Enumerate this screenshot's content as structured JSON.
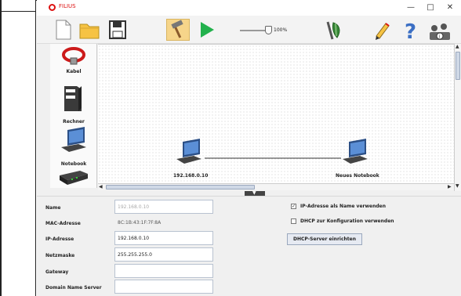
{
  "window": {
    "title": "FILIUS",
    "minimize": "—",
    "maximize": "□",
    "close": "✕"
  },
  "toolbar": {
    "zoom_label": "100%",
    "buttons": [
      "new-file-icon",
      "open-folder-icon",
      "save-icon",
      "design-mode-hammer-icon",
      "run-mode-play-icon",
      "documentation-icon",
      "edit-pencil-icon",
      "help-icon",
      "info-icon"
    ]
  },
  "palette": {
    "items": [
      {
        "label": "Kabel",
        "icon": "cable-icon"
      },
      {
        "label": "Rechner",
        "icon": "computer-icon"
      },
      {
        "label": "Notebook",
        "icon": "notebook-icon"
      },
      {
        "label": "",
        "icon": "switch-icon"
      }
    ]
  },
  "canvas": {
    "devices": [
      {
        "label": "192.168.0.10",
        "icon": "notebook-icon"
      },
      {
        "label": "Neues Notebook",
        "icon": "notebook-icon"
      }
    ]
  },
  "properties": {
    "name_label": "Name",
    "name_value": "192.168.0.10",
    "mac_label": "MAC-Adresse",
    "mac_value": "8C:1B:43:1F:7F:8A",
    "ip_label": "IP-Adresse",
    "ip_value": "192.168.0.10",
    "netmask_label": "Netzmaske",
    "netmask_value": "255.255.255.0",
    "gateway_label": "Gateway",
    "gateway_value": "",
    "dns_label": "Domain Name Server",
    "dns_value": "",
    "ip_as_name_label": "IP-Adresse als Name verwenden",
    "ip_as_name_checked": true,
    "dhcp_config_label": "DHCP zur Konfiguration verwenden",
    "dhcp_config_checked": false,
    "dhcp_server_button": "DHCP-Server einrichten"
  },
  "colors": {
    "accent_red": "#d11111",
    "play_green": "#22b14c",
    "folder_yellow": "#f6c343"
  }
}
